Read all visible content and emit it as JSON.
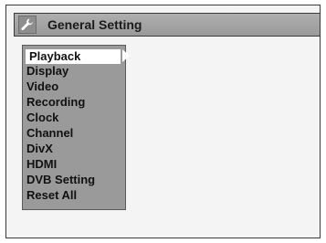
{
  "header": {
    "title": "General Setting",
    "icon": "wrench-icon"
  },
  "menu": {
    "items": [
      {
        "label": "Playback",
        "selected": true
      },
      {
        "label": "Display",
        "selected": false
      },
      {
        "label": "Video",
        "selected": false
      },
      {
        "label": "Recording",
        "selected": false
      },
      {
        "label": "Clock",
        "selected": false
      },
      {
        "label": "Channel",
        "selected": false
      },
      {
        "label": "DivX",
        "selected": false
      },
      {
        "label": "HDMI",
        "selected": false
      },
      {
        "label": "DVB Setting",
        "selected": false
      },
      {
        "label": "Reset All",
        "selected": false
      }
    ]
  },
  "colors": {
    "title_bar": "#a4a4a4",
    "menu_bg": "#9a9a9a",
    "highlight": "#ffffff"
  }
}
